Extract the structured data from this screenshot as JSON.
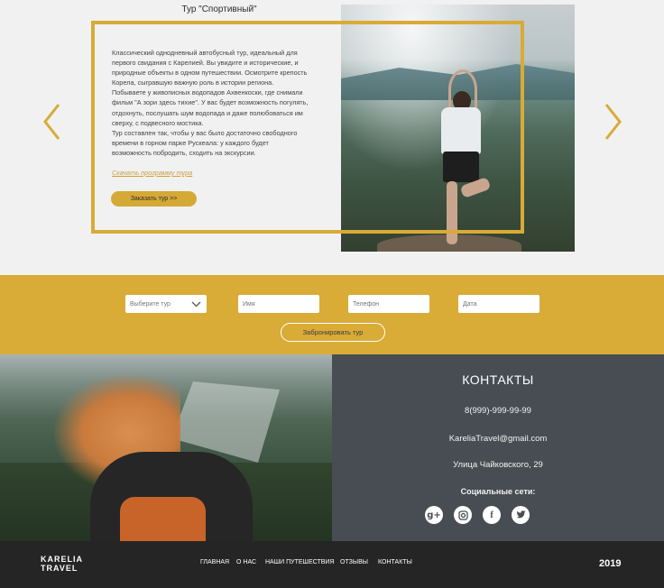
{
  "hero": {
    "title": "Тур \"Спортивный\"",
    "description_lines": [
      "Классический однодневный автобусный тур, идеальный для",
      "первого свидания с Карелией. Вы увидите и исторические, и",
      "природные объекты в одном путешествии. Осмотрите крепость",
      "Корела, сыгравшую важную роль в истории региона.",
      "Побываете у живописных водопадов Ахвенкоски, где снимали",
      "фильм \"А зори здесь тихие\". У вас будет возможность погулять,",
      "отдохнуть, послушать шум водопада и даже полюбоваться им",
      "сверху, с подвесного мостика.",
      "Тур составлен так, чтобы у вас было достаточно свободного",
      "времени в горном парке Рускеала: у каждого будет",
      "возможность побродить, сходить на экскурсии."
    ],
    "download_link": "Скачать программу тура",
    "order_button": "Заказать тур >>",
    "accent_color": "#d8ab36"
  },
  "booking": {
    "tour_select_value": "Выберите тур",
    "name_placeholder": "Имя",
    "phone_placeholder": "Телефон",
    "date_placeholder": "Дата",
    "submit_label": "Забронировать тур",
    "band_color": "#d9ab37"
  },
  "contacts": {
    "title": "КОНТАКТЫ",
    "phone": "8(999)-999-99-99",
    "email": "KareliaTravel@gmail.com",
    "address": "Улица Чайковского, 29",
    "social_label": "Социальные сети:",
    "social_icons": [
      "google-plus-icon",
      "instagram-icon",
      "facebook-icon",
      "twitter-icon"
    ]
  },
  "footer": {
    "logo_line1": "KARELIA",
    "logo_line2": "TRAVEL",
    "nav": [
      "ГЛАВНАЯ",
      "О НАС",
      "НАШИ ПУТЕШЕСТВИЯ",
      "ОТЗЫВЫ",
      "КОНТАКТЫ"
    ],
    "year": "2019"
  }
}
